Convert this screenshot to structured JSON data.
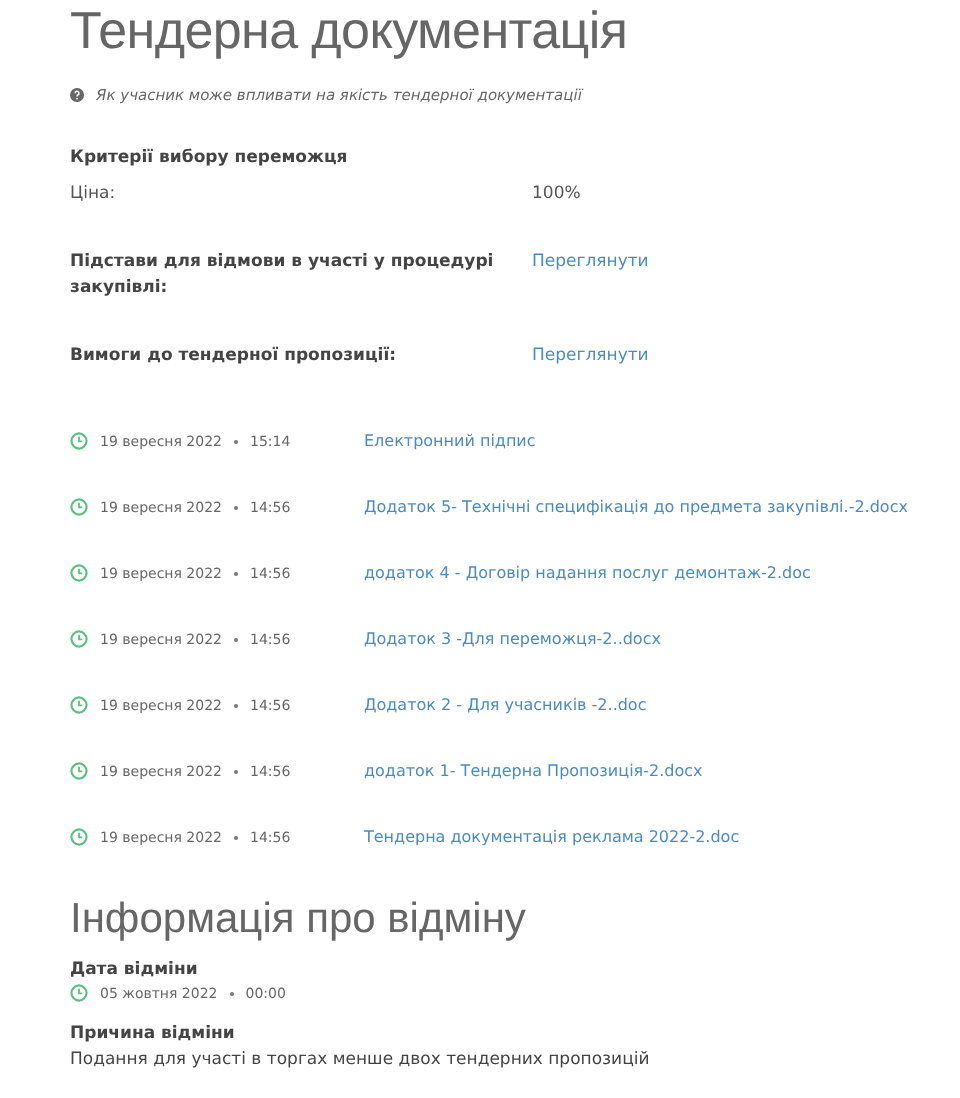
{
  "title": "Тендерна документація",
  "hint": "Як учасник може впливати на якість тендерної документації",
  "criteria": {
    "heading": "Критерії вибору переможця",
    "rows": [
      {
        "label": "Ціна:",
        "value": "100%"
      }
    ]
  },
  "info_rows": [
    {
      "label": "Підстави для відмови в участі у процедурі закупівлі:",
      "link": "Переглянути"
    },
    {
      "label": "Вимоги до тендерної пропозиції:",
      "link": "Переглянути"
    }
  ],
  "documents": [
    {
      "date": "19 вересня 2022",
      "time": "15:14",
      "name": "Електронний підпис"
    },
    {
      "date": "19 вересня 2022",
      "time": "14:56",
      "name": "Додаток 5- Технічні специфікація до предмета закупівлі.-2.docx"
    },
    {
      "date": "19 вересня 2022",
      "time": "14:56",
      "name": "додаток 4 - Договір надання послуг демонтаж-2.doc"
    },
    {
      "date": "19 вересня 2022",
      "time": "14:56",
      "name": "Додаток 3 -Для переможця-2..docx"
    },
    {
      "date": "19 вересня 2022",
      "time": "14:56",
      "name": "Додаток 2 - Для учасників -2..doc"
    },
    {
      "date": "19 вересня 2022",
      "time": "14:56",
      "name": "додаток 1- Тендерна Пропозиція-2.docx"
    },
    {
      "date": "19 вересня 2022",
      "time": "14:56",
      "name": "Тендерна документація реклама 2022-2.doc"
    }
  ],
  "cancellation": {
    "title": "Інформація про відміну",
    "date_label": "Дата відміни",
    "date": "05 жовтня 2022",
    "time": "00:00",
    "reason_label": "Причина відміни",
    "reason": "Подання для участі в торгах менше двох тендерних пропозицій"
  }
}
